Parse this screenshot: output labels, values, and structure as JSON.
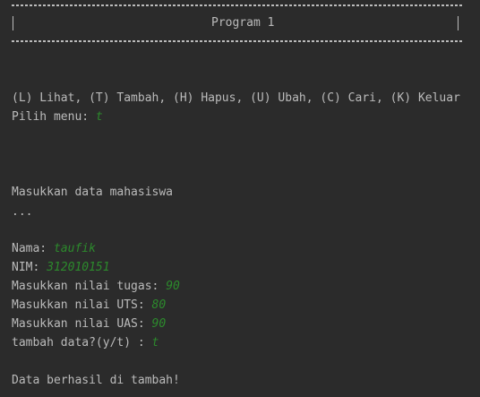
{
  "header": {
    "title": "Program 1",
    "border_char": "="
  },
  "menu": {
    "options": "(L) Lihat, (T) Tambah, (H) Hapus, (U) Ubah, (C) Cari, (K) Keluar",
    "prompt": "Pilih menu: ",
    "input": "t"
  },
  "form": {
    "heading": "Masukkan data mahasiswa",
    "ellipsis": "...",
    "fields": [
      {
        "label": "Nama: ",
        "value": "taufik"
      },
      {
        "label": "NIM: ",
        "value": "312010151"
      },
      {
        "label": "Masukkan nilai tugas: ",
        "value": "90"
      },
      {
        "label": "Masukkan nilai UTS: ",
        "value": "80"
      },
      {
        "label": "Masukkan nilai UAS: ",
        "value": "90"
      },
      {
        "label": "tambah data?(y/t) : ",
        "value": "t"
      }
    ]
  },
  "result": {
    "message": "Data berhasil di tambah!"
  },
  "colors": {
    "background": "#2b2b2b",
    "text": "#bbbbbb",
    "user_input": "#2c8a2c"
  }
}
